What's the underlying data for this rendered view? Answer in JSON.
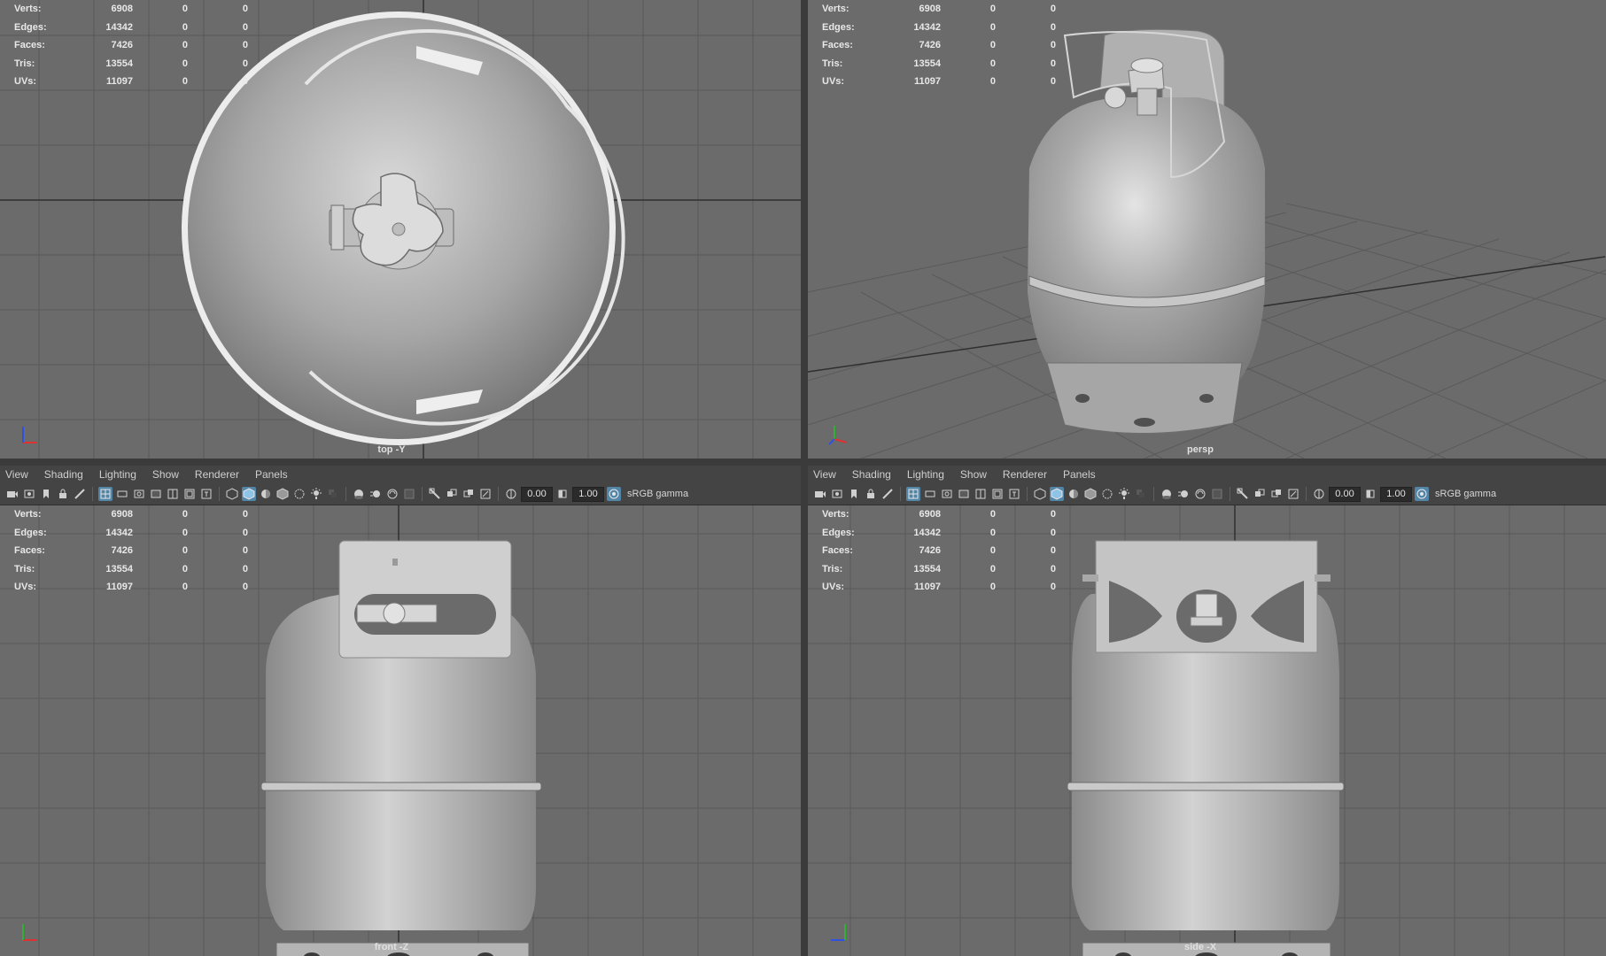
{
  "hud_stats": [
    {
      "label": "Verts:",
      "value": "6908",
      "a": "0",
      "b": "0"
    },
    {
      "label": "Edges:",
      "value": "14342",
      "a": "0",
      "b": "0"
    },
    {
      "label": "Faces:",
      "value": "7426",
      "a": "0",
      "b": "0"
    },
    {
      "label": "Tris:",
      "value": "13554",
      "a": "0",
      "b": "0"
    },
    {
      "label": "UVs:",
      "value": "11097",
      "a": "0",
      "b": "0"
    }
  ],
  "menu": [
    "View",
    "Shading",
    "Lighting",
    "Show",
    "Renderer",
    "Panels"
  ],
  "toolbar": {
    "exposure": "0.00",
    "gamma": "1.00",
    "color_space": "sRGB gamma"
  },
  "viewports": {
    "top": {
      "camera": "top -Y"
    },
    "persp": {
      "camera": "persp"
    },
    "front": {
      "camera": "front -Z"
    },
    "side": {
      "camera": "side -X"
    }
  },
  "colors": {
    "viewport_bg": "#6b6b6b",
    "grid_line": "#5a5a5a",
    "grid_axis": "#2f2f2f",
    "active_tool": "#5285a6",
    "model": "#b9b9b9"
  },
  "icons": [
    "camera-icon",
    "bookmark-icon",
    "grid-icon",
    "wireframe-icon",
    "smooth-shade-icon",
    "light-icon",
    "isolate-icon",
    "exposure-icon",
    "gamma-icon",
    "colorspace-icon"
  ]
}
